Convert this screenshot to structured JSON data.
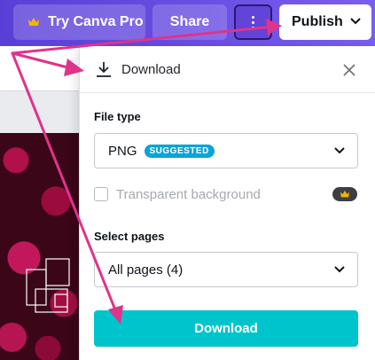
{
  "topbar": {
    "try_pro_label": "Try Canva Pro",
    "share_label": "Share",
    "publish_label": "Publish",
    "gradient_start": "#5a3fd6",
    "gradient_end": "#7a5ef0"
  },
  "panel": {
    "title": "Download",
    "file_type": {
      "label": "File type",
      "value": "PNG",
      "badge": "SUGGESTED"
    },
    "transparent_background": {
      "label": "Transparent background",
      "checked": false
    },
    "select_pages": {
      "label": "Select pages",
      "value": "All pages (4)"
    },
    "download_button_label": "Download",
    "accent_color": "#00c4cc",
    "badge_color": "#0aa4d6"
  },
  "annotation": {
    "arrow_color": "#e0338a"
  },
  "icons": [
    "crown-icon",
    "more-icon",
    "chevron-down-icon",
    "download-icon",
    "close-icon"
  ]
}
